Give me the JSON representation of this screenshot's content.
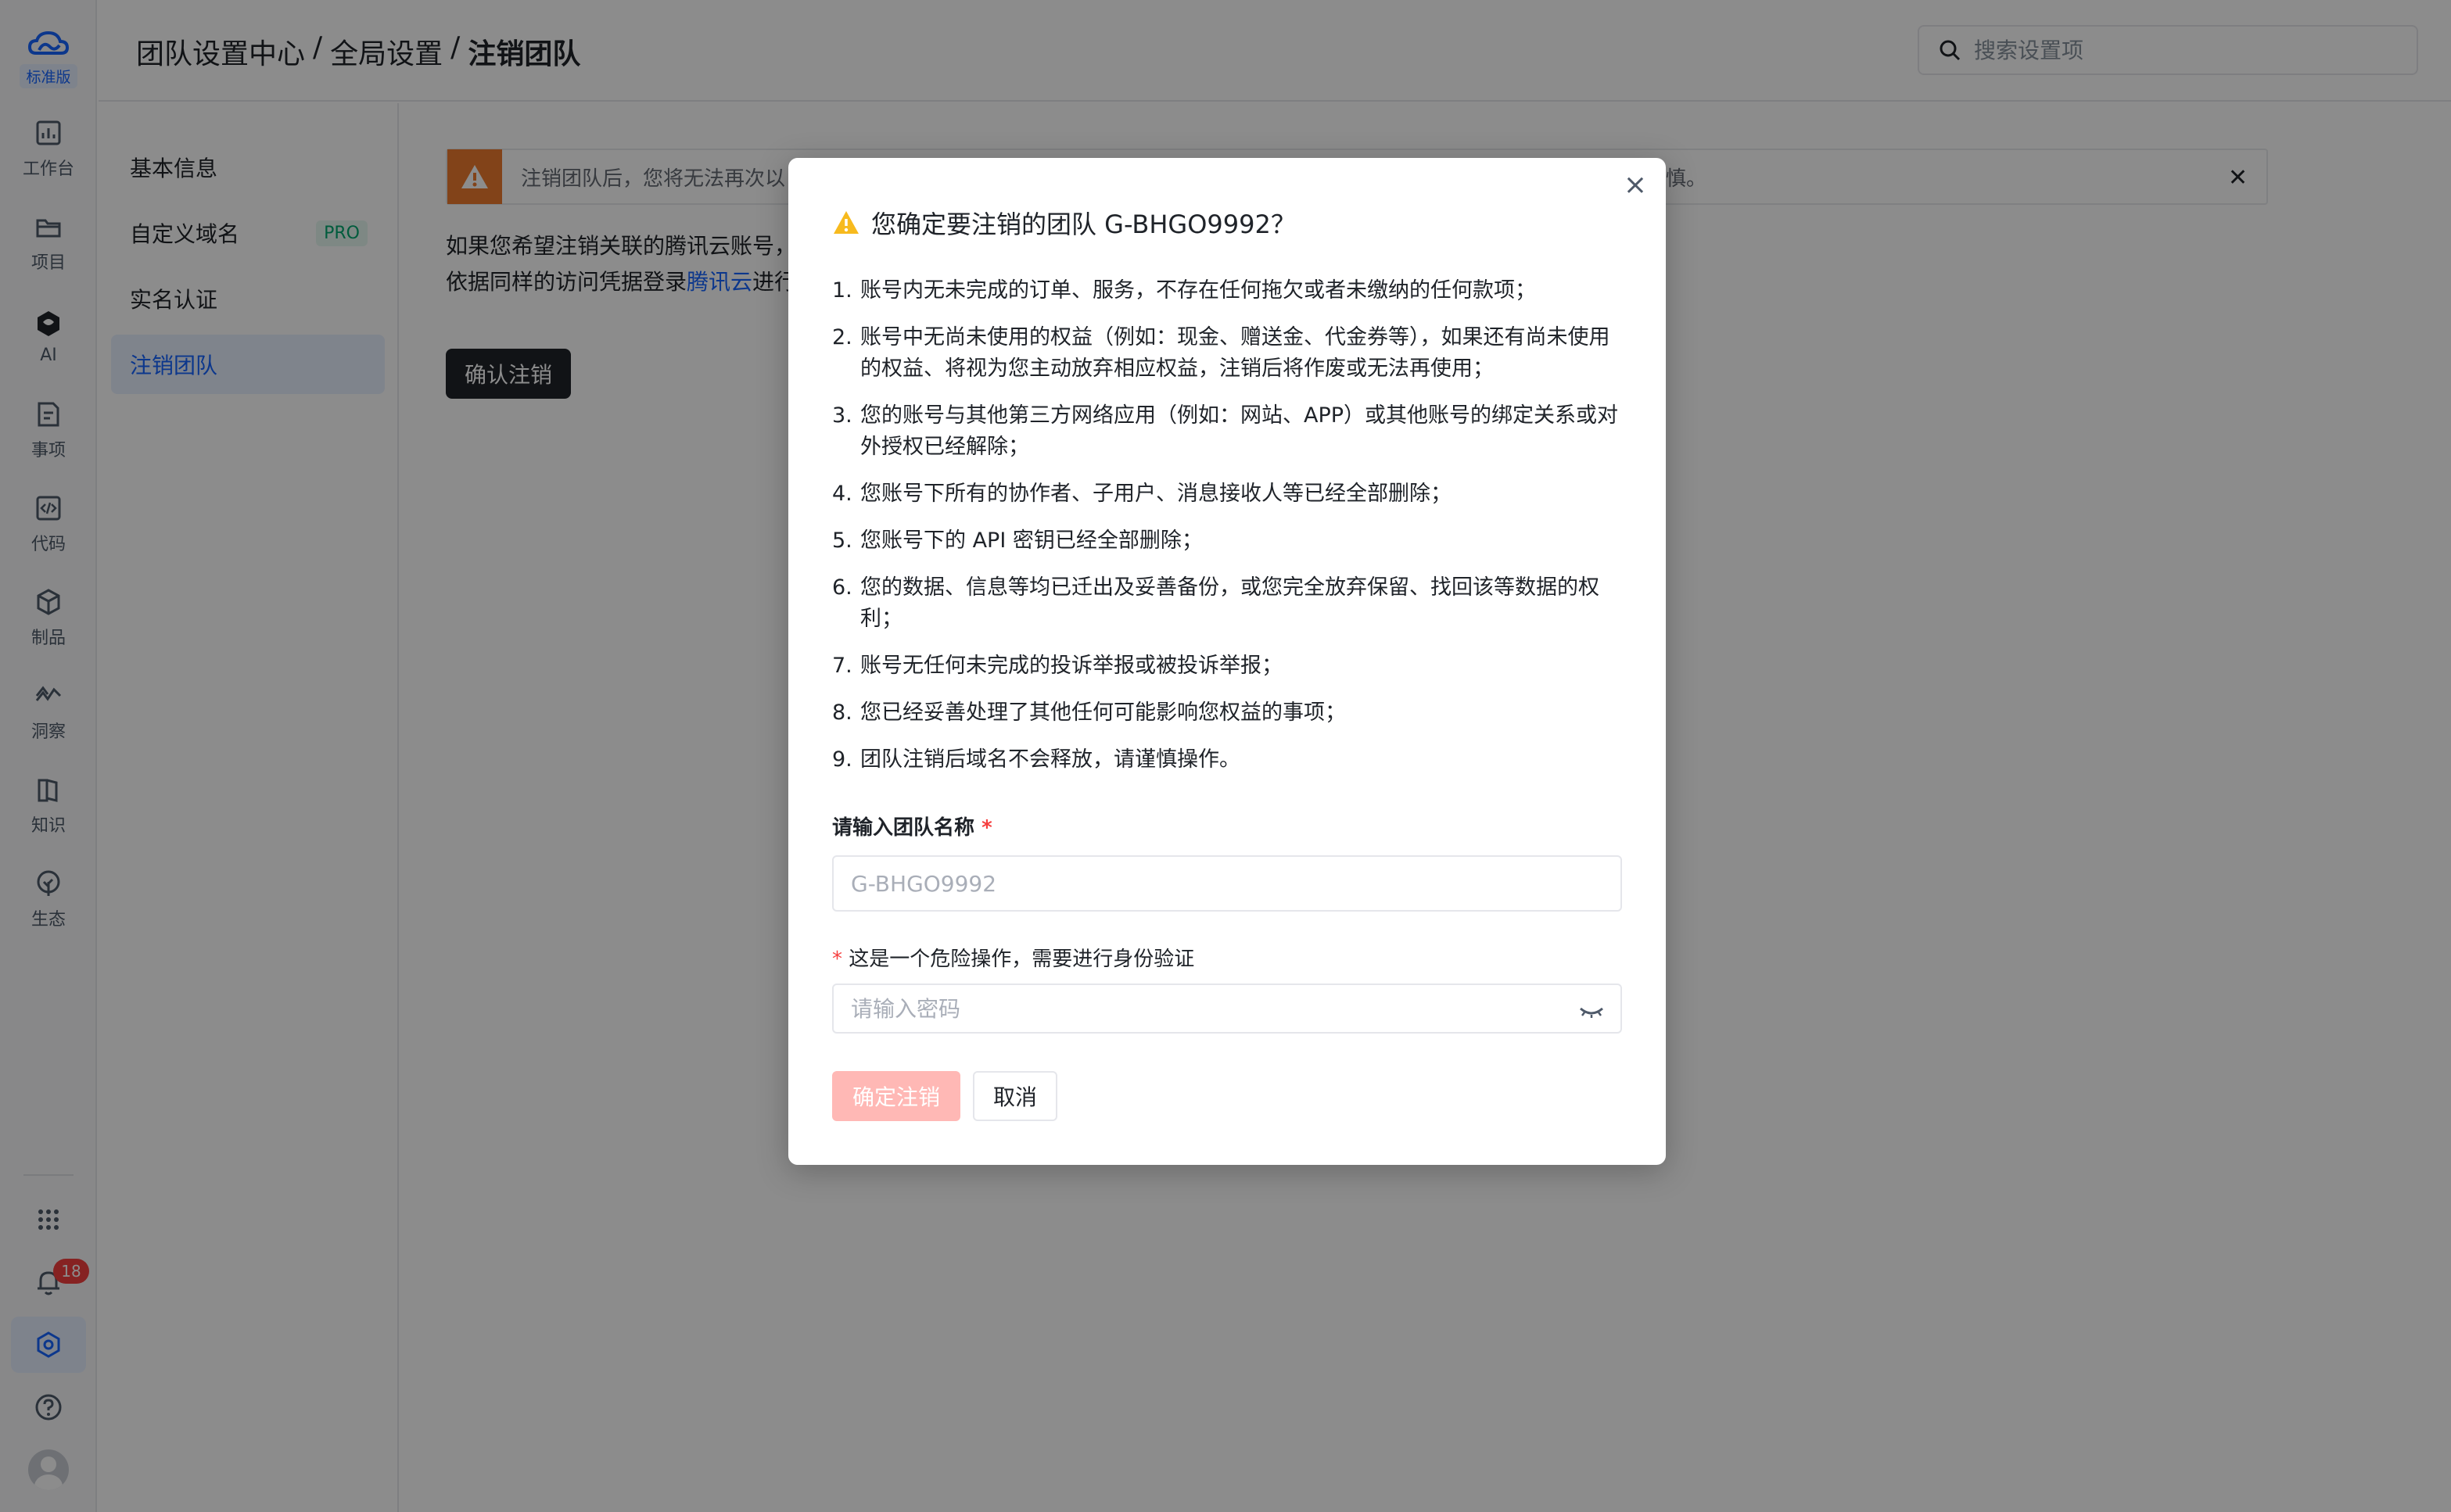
{
  "rail": {
    "edition": "标准版",
    "items": [
      {
        "label": "工作台",
        "icon": "chart-icon"
      },
      {
        "label": "项目",
        "icon": "folder-icon"
      },
      {
        "label": "AI",
        "icon": "ai-icon"
      },
      {
        "label": "事项",
        "icon": "task-icon"
      },
      {
        "label": "代码",
        "icon": "code-icon"
      },
      {
        "label": "制品",
        "icon": "package-icon"
      },
      {
        "label": "洞察",
        "icon": "insight-icon"
      },
      {
        "label": "知识",
        "icon": "book-icon"
      },
      {
        "label": "生态",
        "icon": "plant-icon"
      }
    ],
    "notification_count": "18"
  },
  "header": {
    "breadcrumb": [
      "团队设置中心",
      "/",
      "全局设置",
      "/",
      "注销团队"
    ],
    "search_placeholder": "搜索设置项"
  },
  "subnav": {
    "items": [
      "基本信息",
      "自定义域名",
      "实名认证",
      "注销团队"
    ],
    "pro_badge": "PRO"
  },
  "content": {
    "alert_text_start": "注销团队后，您将无法再次以",
    "alert_text_end": "谨慎。",
    "desc_line1": "如果您希望注销关联的腾讯云账号，",
    "desc_line2_pre": "依据同样的访问凭据登录",
    "desc_link": "腾讯云",
    "desc_line2_post": "进行",
    "confirm_button": "确认注销"
  },
  "modal": {
    "title": "您确定要注销的团队 G-BHGO9992？",
    "conditions": [
      "账号内无未完成的订单、服务，不存在任何拖欠或者未缴纳的任何款项；",
      "账号中无尚未使用的权益（例如：现金、赠送金、代金券等），如果还有尚未使用的权益、将视为您主动放弃相应权益，注销后将作废或无法再使用；",
      "您的账号与其他第三方网络应用（例如：网站、APP）或其他账号的绑定关系或对外授权已经解除；",
      "您账号下所有的协作者、子用户、消息接收人等已经全部删除；",
      "您账号下的 API 密钥已经全部删除；",
      "您的数据、信息等均已迁出及妥善备份，或您完全放弃保留、找回该等数据的权利；",
      "账号无任何未完成的投诉举报或被投诉举报；",
      "您已经妥善处理了其他任何可能影响您权益的事项；",
      "团队注销后域名不会释放，请谨慎操作。"
    ],
    "team_name_label": "请输入团队名称",
    "team_name_placeholder": "G-BHGO9992",
    "verify_label": "这是一个危险操作，需要进行身份验证",
    "password_placeholder": "请输入密码",
    "confirm_button": "确定注销",
    "cancel_button": "取消",
    "required_mark": "*",
    "close_glyph": "×"
  },
  "colors": {
    "accent": "#1664ff",
    "danger_disabled": "#ffb8b5",
    "warning": "#ed7b2f"
  }
}
